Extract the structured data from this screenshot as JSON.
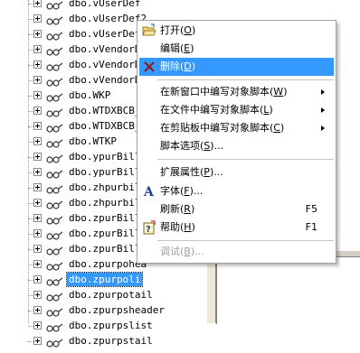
{
  "tree": {
    "items": [
      {
        "label": "dbo.vUserDef",
        "selected": false
      },
      {
        "label": "dbo.vUserDef2",
        "selected": false
      },
      {
        "label": "dbo.vUserDef",
        "selected": false
      },
      {
        "label": "dbo.vVendorDe",
        "selected": false
      },
      {
        "label": "dbo.vVendorDe",
        "selected": false
      },
      {
        "label": "dbo.vVendorDe",
        "selected": false
      },
      {
        "label": "dbo.WKP",
        "selected": false
      },
      {
        "label": "dbo.WTDXBCB_",
        "selected": false
      },
      {
        "label": "dbo.WTDXBCB_",
        "selected": false
      },
      {
        "label": "dbo.WTKP",
        "selected": false
      },
      {
        "label": "dbo.ypurBill",
        "selected": false
      },
      {
        "label": "dbo.ypurBill",
        "selected": false
      },
      {
        "label": "dbo.zhpurbill",
        "selected": false
      },
      {
        "label": "dbo.zhpurbill",
        "selected": false
      },
      {
        "label": "dbo.zpurBill",
        "selected": false
      },
      {
        "label": "dbo.zpurBill",
        "selected": false
      },
      {
        "label": "dbo.zpurBill",
        "selected": false
      },
      {
        "label": "dbo.zpurpohea",
        "selected": false
      },
      {
        "label": "dbo.zpurpoli",
        "selected": true
      },
      {
        "label": "dbo.zpurpotail",
        "selected": false
      },
      {
        "label": "dbo.zpurpsheader",
        "selected": false
      },
      {
        "label": "dbo.zpurpslist",
        "selected": false
      },
      {
        "label": "dbo.zpurpstail",
        "selected": false
      }
    ]
  },
  "menu": {
    "open": {
      "label": "打开",
      "key": "O",
      "shortcut": ""
    },
    "edit": {
      "label": "编辑",
      "key": "E",
      "shortcut": ""
    },
    "delete": {
      "label": "删除",
      "key": "D",
      "shortcut": ""
    },
    "script_new_window": {
      "label": "在新窗口中编写对象脚本",
      "key": "W"
    },
    "script_file": {
      "label": "在文件中编写对象脚本",
      "key": "L"
    },
    "script_clipboard": {
      "label": "在剪贴板中编写对象脚本",
      "key": "C"
    },
    "script_options": {
      "label": "脚本选项",
      "key": "S",
      "suffix": "..."
    },
    "extended_props": {
      "label": "扩展属性",
      "key": "P",
      "suffix": "..."
    },
    "font": {
      "label": "字体",
      "key": "F",
      "suffix": "..."
    },
    "refresh": {
      "label": "刷新",
      "key": "R",
      "shortcut": "F5"
    },
    "help": {
      "label": "帮助",
      "key": "H",
      "shortcut": "F1"
    },
    "debug": {
      "label": "调试",
      "key": "B",
      "suffix": "..."
    }
  },
  "colors": {
    "highlight": "#3399ff",
    "delete_icon": "#8b1a1a",
    "font_icon": "#1c3f94"
  }
}
